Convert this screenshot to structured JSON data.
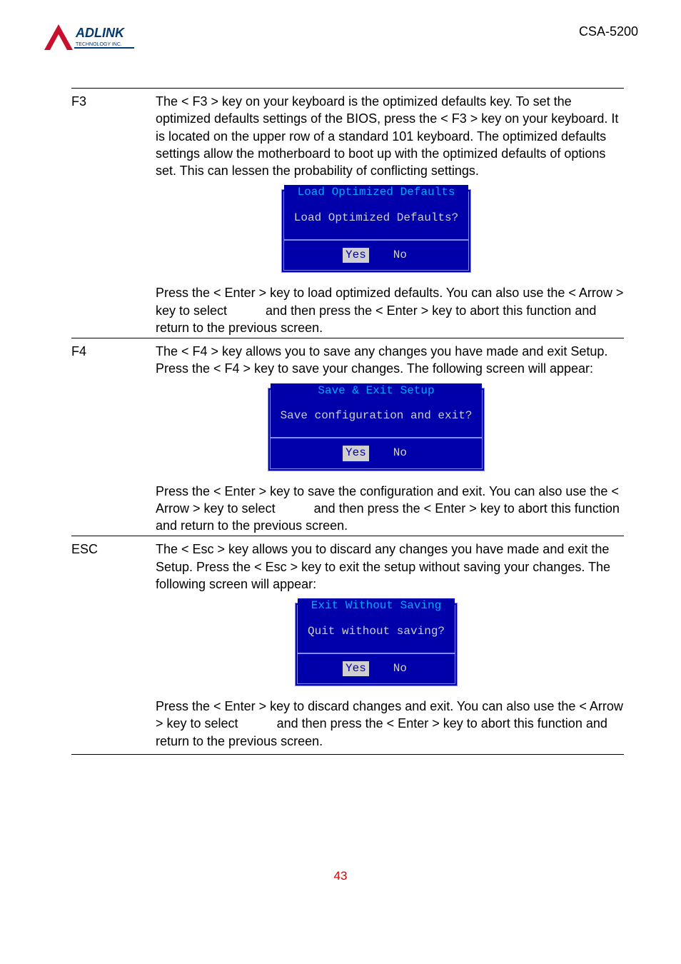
{
  "header": {
    "logo_brand_top": "ADLINK",
    "logo_brand_sub": "TECHNOLOGY INC.",
    "doc_id": "CSA-5200"
  },
  "rows": {
    "f3": {
      "key": "F3",
      "para1": "The < F3 > key on your keyboard is the optimized defaults key. To set the optimized defaults settings of the BIOS, press the < F3 > key on your keyboard. It is located on the upper row of a standard 101 keyboard. The optimized defaults settings allow the motherboard to boot up with the optimized defaults of options set. This can lessen the probability of conflicting settings.",
      "dialog": {
        "title": "Load Optimized Defaults",
        "body": "Load Optimized Defaults?",
        "yes": "Yes",
        "no": "No"
      },
      "para2_a": "Press the < Enter > key to load optimized defaults. You can also use the < Arrow > key to select ",
      "para2_b": " and then press the < Enter > key to abort this function and return to the previous screen."
    },
    "f4": {
      "key": "F4",
      "para1": "The < F4 > key allows you to save any changes you have made and exit Setup. Press the < F4 > key to save your changes. The following screen will appear:",
      "dialog": {
        "title": "Save & Exit Setup",
        "body": "Save configuration and exit?",
        "yes": "Yes",
        "no": "No"
      },
      "para2_a": "Press the < Enter > key to save the configuration and exit. You can also use the < Arrow > key to select ",
      "para2_b": " and then press the < Enter > key to abort this function and return to the previous screen."
    },
    "esc": {
      "key": "ESC",
      "para1": "The < Esc > key allows you to discard any changes you have made and exit the Setup. Press the < Esc > key to exit the setup without saving your changes. The following screen will appear:",
      "dialog": {
        "title": "Exit Without Saving",
        "body": "Quit without saving?",
        "yes": "Yes",
        "no": "No"
      },
      "para2_a": "Press the < Enter > key to discard changes and exit. You can also use the < Arrow > key to select ",
      "para2_b": " and then press the < Enter > key to abort this function and return to the previous screen."
    }
  },
  "page_number": "43"
}
